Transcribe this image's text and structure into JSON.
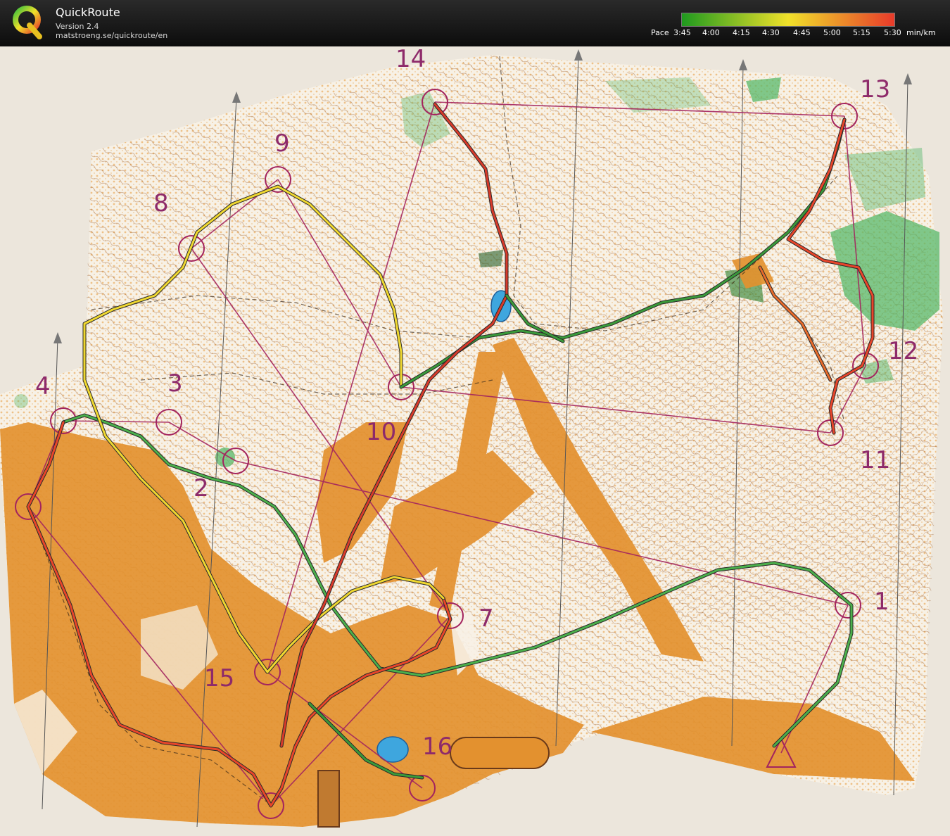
{
  "header": {
    "app_name": "QuickRoute",
    "version": "Version 2.4",
    "url": "matstroeng.se/quickroute/en"
  },
  "pace_legend": {
    "prefix": "Pace",
    "ticks": [
      "3:45",
      "4:00",
      "4:15",
      "4:30",
      "4:45",
      "5:00",
      "5:15",
      "5:30"
    ],
    "unit": "min/km",
    "colors": {
      "fast": "#1f9a1f",
      "medium": "#f0e12a",
      "slow": "#e83a2a"
    }
  },
  "map": {
    "control_numbers": [
      "1",
      "2",
      "3",
      "4",
      "7",
      "8",
      "9",
      "10",
      "11",
      "12",
      "13",
      "14",
      "15",
      "16"
    ],
    "colors": {
      "course": "#a3245e",
      "open_land": "#e79a3a",
      "forest": "#f7f2e8",
      "green": "#59b86a",
      "water": "#3ea6de",
      "contour": "#9b5a2a"
    }
  }
}
